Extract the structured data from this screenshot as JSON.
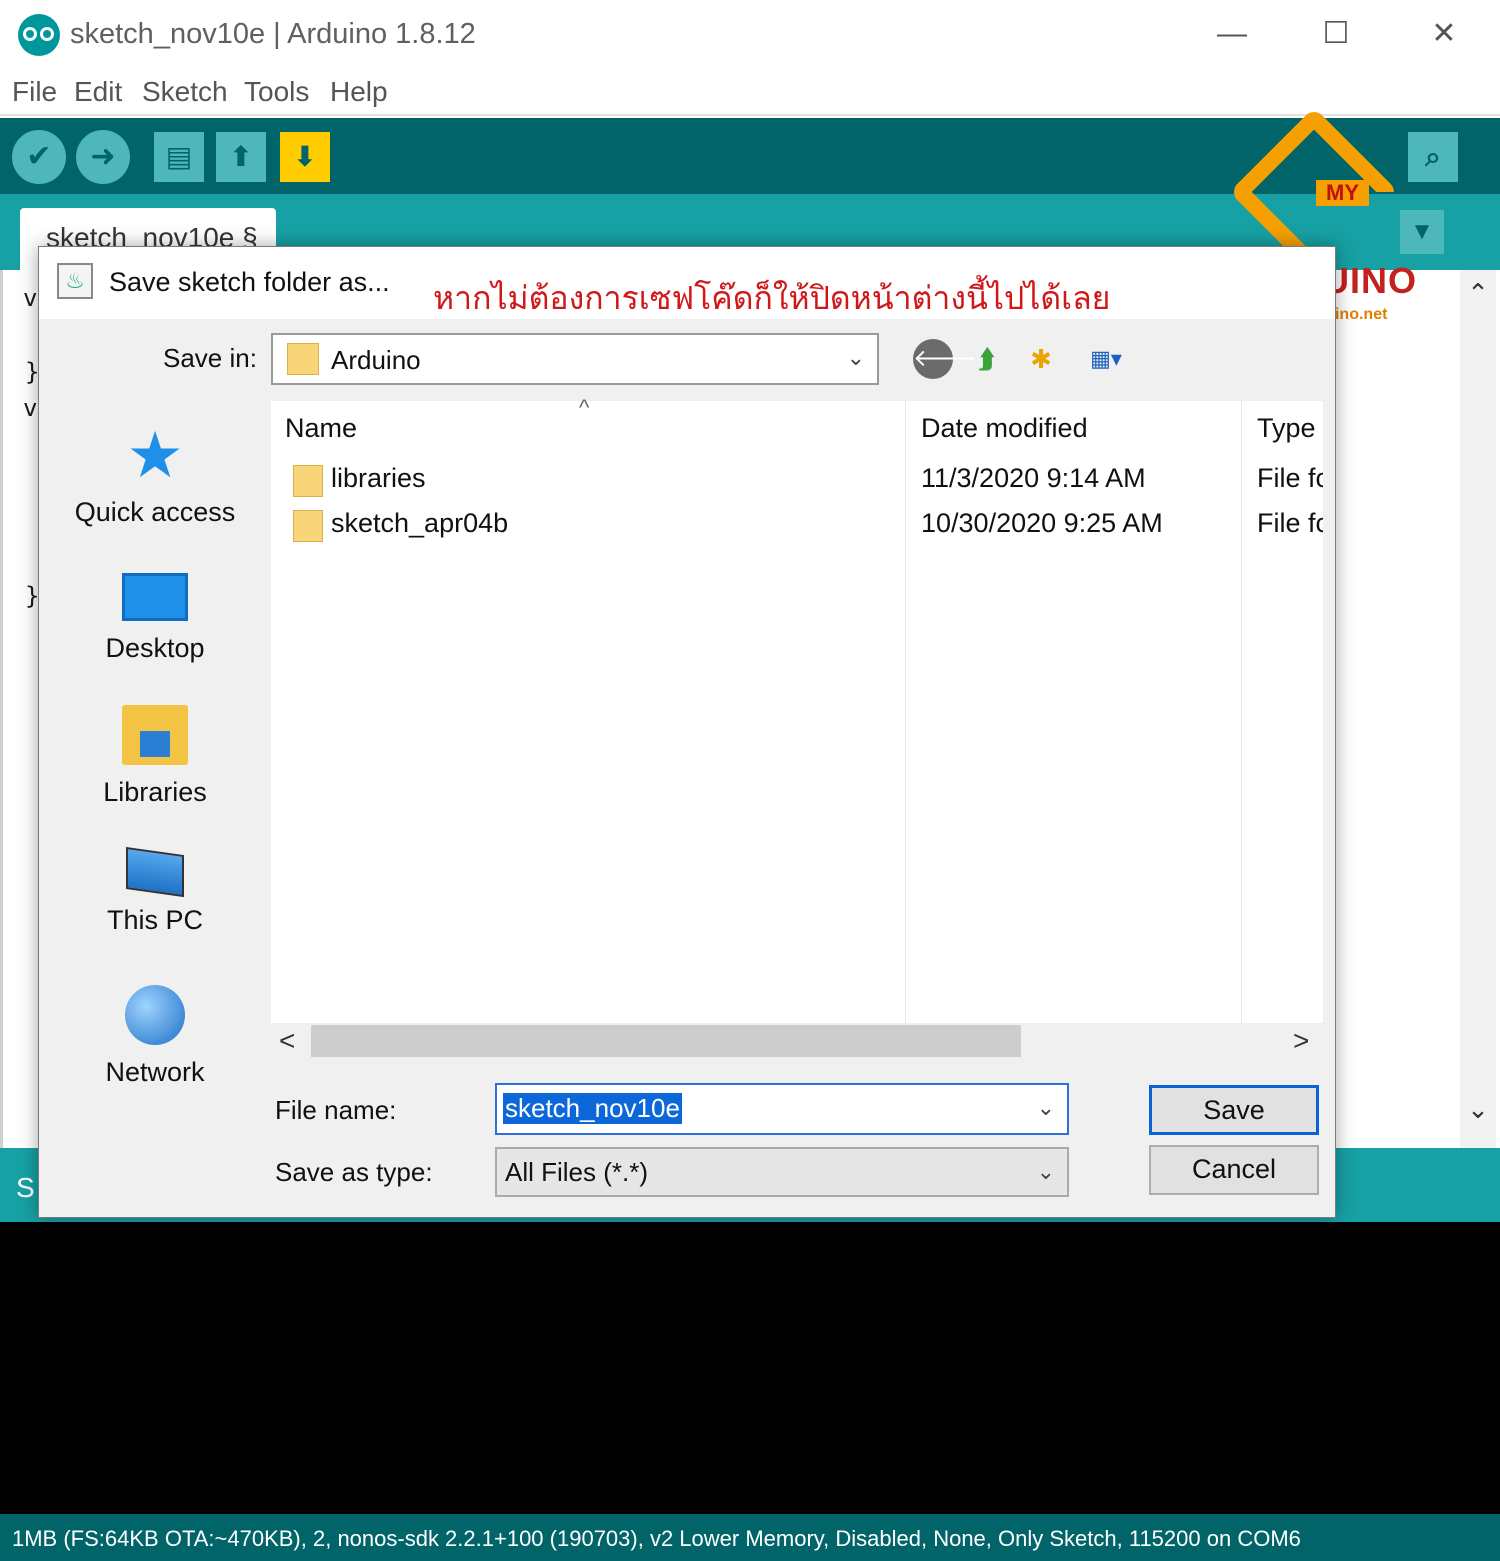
{
  "window": {
    "title": "sketch_nov10e | Arduino 1.8.12",
    "minimize": "—",
    "maximize": "☐",
    "close": "✕"
  },
  "menu": [
    "File",
    "Edit",
    "Sketch",
    "Tools",
    "Help"
  ],
  "toolbar": {
    "verify_icon": "✔",
    "upload_icon": "➜",
    "new_icon": "▤",
    "open_icon": "⬆",
    "save_icon": "⬇",
    "serial_monitor_icon": "⌕",
    "accent_color": "#006468",
    "button_color": "#4db7bb",
    "save_button_color": "#ffcc00"
  },
  "tab": {
    "label": "sketch_nov10e §",
    "menu_icon": "▼"
  },
  "editor": {
    "visible_glyphs": [
      "v",
      "}",
      "v",
      "}"
    ],
    "scroll_up": "⌃",
    "scroll_down": "⌄"
  },
  "status_strip_text": "S",
  "bottom_status": "1MB (FS:64KB OTA:~470KB), 2, nonos-sdk 2.2.1+100 (190703), v2 Lower Memory, Disabled, None, Only Sketch, 115200 on COM6",
  "watermark": {
    "badge": "MY",
    "brand": "ARDUINO",
    "url": "www.myarduino.net"
  },
  "dialog": {
    "title": "Save sketch folder as...",
    "annotation": "หากไม่ต้องการเซฟโค๊ดก็ให้ปิดหน้าต่างนี้ไปได้เลย",
    "save_in_label": "Save in:",
    "save_in_value": "Arduino",
    "nav_icons": {
      "back": "🡐",
      "up": "⮭",
      "new_folder": "✱",
      "view": "▦▾"
    },
    "places": [
      "Quick access",
      "Desktop",
      "Libraries",
      "This PC",
      "Network"
    ],
    "columns": [
      "Name",
      "Date modified",
      "Type"
    ],
    "sort_indicator": "^",
    "files": [
      {
        "name": "libraries",
        "date": "11/3/2020 9:14 AM",
        "type": "File fc"
      },
      {
        "name": "sketch_apr04b",
        "date": "10/30/2020 9:25 AM",
        "type": "File fc"
      }
    ],
    "scroll_left": "<",
    "scroll_right": ">",
    "file_name_label": "File name:",
    "file_name_value": "sketch_nov10e",
    "save_as_type_label": "Save as type:",
    "save_as_type_value": "All Files (*.*)",
    "combo_chevron": "⌄",
    "save_button": "Save",
    "cancel_button": "Cancel"
  }
}
